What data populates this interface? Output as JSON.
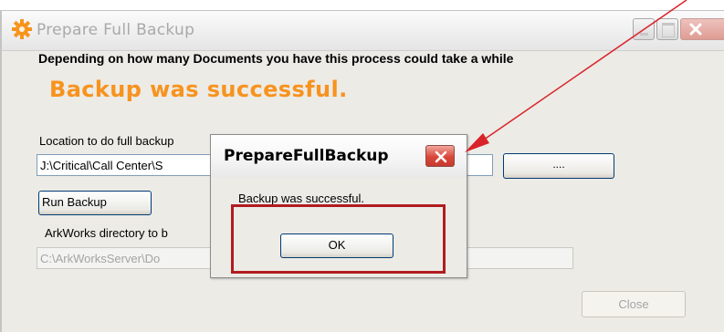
{
  "window": {
    "title": "Prepare Full Backup",
    "instructions": "Depending on how many Documents you have this process could take a while",
    "status": "Backup was successful.",
    "location_label": "Location to do full backup",
    "location_value": "J:\\Critical\\Call Center\\S",
    "browse_label": "....",
    "run_label": "Run Backup",
    "dir_label": "ArkWorks directory to b",
    "dir_value": "C:\\ArkWorksServer\\Do",
    "close_label": "Close"
  },
  "dialog": {
    "title": "PrepareFullBackup",
    "message": "Backup was successful.",
    "ok_label": "OK"
  },
  "colors": {
    "status": "#f7931e",
    "annotation": "#b01c20",
    "arrow": "#d9232a"
  }
}
